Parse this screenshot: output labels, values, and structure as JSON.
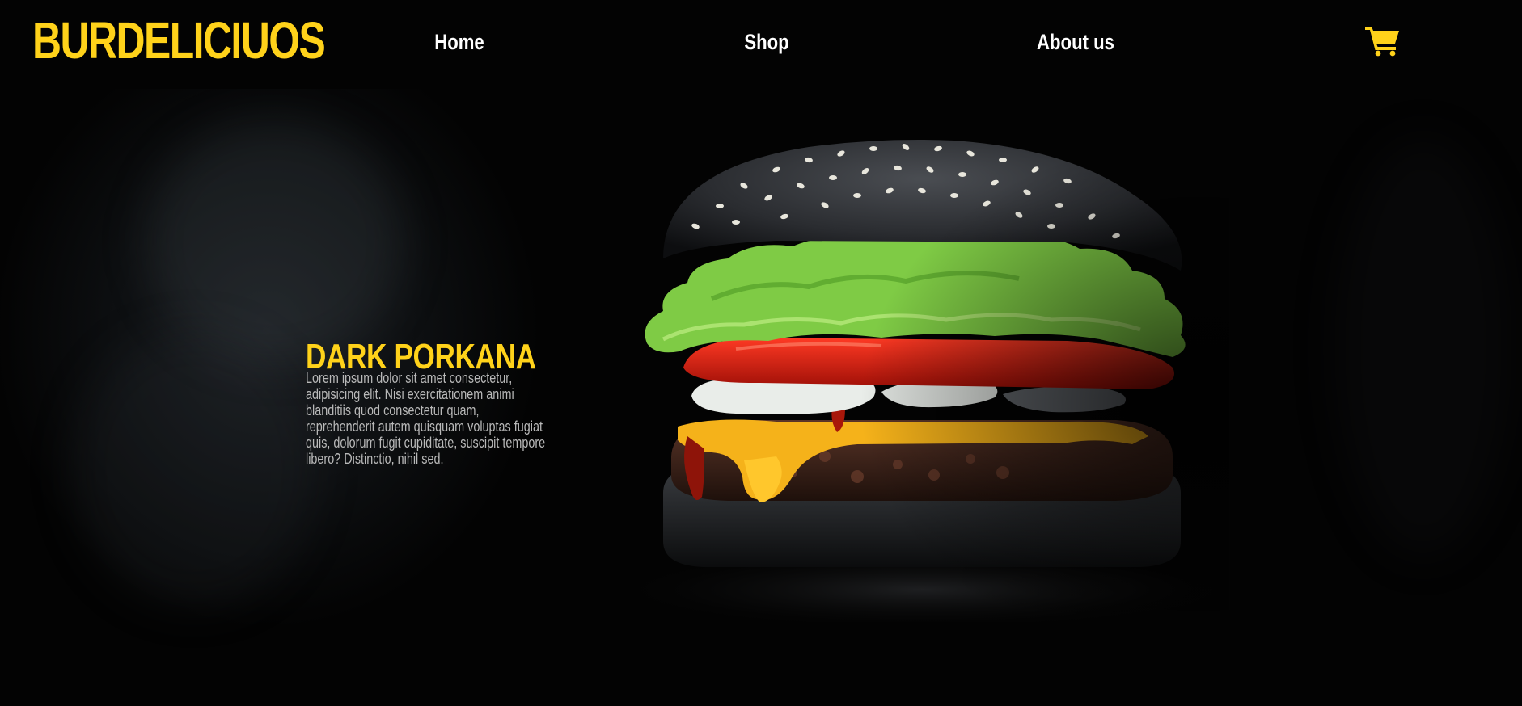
{
  "brand": {
    "logo_text": "BURDELICIUOS",
    "accent_color": "#FFD21A"
  },
  "nav": {
    "home_label": "Home",
    "shop_label": "Shop",
    "about_label": "About us",
    "cart_icon": "shopping-cart-icon"
  },
  "hero": {
    "product_title": "DARK PORKANA",
    "product_description": "Lorem ipsum dolor sit amet consectetur, adipisicing elit. Nisi exercitationem animi blanditiis quod consectetur quam, reprehenderit autem quisquam voluptas fugiat quis, dolorum fugit cupiditate, suscipit tempore libero? Distinctio, nihil sed.",
    "image": "black-bun-burger-photo"
  }
}
